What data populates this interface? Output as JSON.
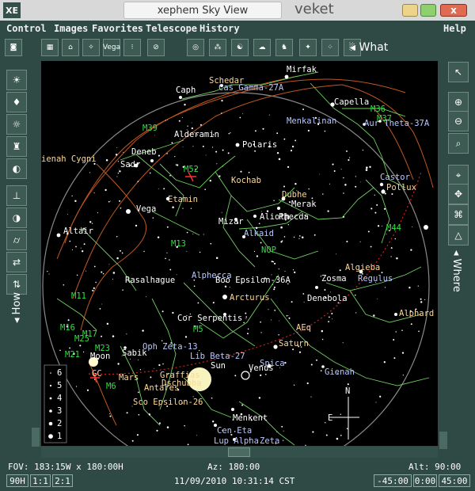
{
  "window": {
    "badge": "XE",
    "title": "xephem Sky View",
    "host": "veket",
    "close_label": "x"
  },
  "menu": {
    "items": [
      "Control",
      "Images",
      "Favorites",
      "Telescope",
      "History"
    ],
    "help": "Help"
  },
  "toolbar": {
    "what_label": "What",
    "vega_label": "Vega"
  },
  "side": {
    "how_label": "How",
    "where_label": "Where"
  },
  "sky": {
    "stars": [
      {
        "name": "Schedar",
        "class": "cons-l"
      },
      {
        "name": "Mirfak",
        "class": "star-l"
      },
      {
        "name": "Caph",
        "class": "star-l"
      },
      {
        "name": "Cas Gamma-27A",
        "class": "blue-l"
      },
      {
        "name": "Capella",
        "class": "star-l"
      },
      {
        "name": "M36",
        "class": "obj-l"
      },
      {
        "name": "M37",
        "class": "obj-l"
      },
      {
        "name": "Menkalinan",
        "class": "blue-l"
      },
      {
        "name": "Aur Theta-37A",
        "class": "blue-l"
      },
      {
        "name": "M39",
        "class": "obj-l"
      },
      {
        "name": "Alderamin",
        "class": "star-l"
      },
      {
        "name": "Polaris",
        "class": "star-l"
      },
      {
        "name": "ienah Cygni",
        "class": "cons-l"
      },
      {
        "name": "Deneb",
        "class": "star-l"
      },
      {
        "name": "Sadr",
        "class": "star-l"
      },
      {
        "name": "M52",
        "class": "obj-l"
      },
      {
        "name": "Kochab",
        "class": "cons-l"
      },
      {
        "name": "Castor",
        "class": "blue-l"
      },
      {
        "name": "Pollux",
        "class": "cons-l"
      },
      {
        "name": "Etamin",
        "class": "cons-l"
      },
      {
        "name": "Dubhe",
        "class": "cons-l"
      },
      {
        "name": "Merak",
        "class": "star-l"
      },
      {
        "name": "Vega",
        "class": "star-l"
      },
      {
        "name": "Mizar",
        "class": "star-l"
      },
      {
        "name": "Alioth",
        "class": "star-l"
      },
      {
        "name": "Phecda",
        "class": "star-l"
      },
      {
        "name": "Alkaid",
        "class": "blue-l"
      },
      {
        "name": "Altair",
        "class": "star-l"
      },
      {
        "name": "M44",
        "class": "obj-l"
      },
      {
        "name": "M13",
        "class": "obj-l"
      },
      {
        "name": "NOP",
        "class": "obj-l"
      },
      {
        "name": "Algieba",
        "class": "cons-l"
      },
      {
        "name": "Rasalhague",
        "class": "star-l"
      },
      {
        "name": "Alphecca",
        "class": "blue-l"
      },
      {
        "name": "Boo Epsilon-36A",
        "class": "star-l"
      },
      {
        "name": "Zosma",
        "class": "star-l"
      },
      {
        "name": "Regulus",
        "class": "blue-l"
      },
      {
        "name": "M11",
        "class": "obj-l"
      },
      {
        "name": "Arcturus",
        "class": "cons-l"
      },
      {
        "name": "Denebola",
        "class": "star-l"
      },
      {
        "name": "Cor Serpentis",
        "class": "star-l"
      },
      {
        "name": "M5",
        "class": "obj-l"
      },
      {
        "name": "Alphard",
        "class": "cons-l"
      },
      {
        "name": "M16",
        "class": "obj-l"
      },
      {
        "name": "M17",
        "class": "obj-l"
      },
      {
        "name": "M25",
        "class": "obj-l"
      },
      {
        "name": "AEq",
        "class": "pl-l"
      },
      {
        "name": "M23",
        "class": "obj-l"
      },
      {
        "name": "Oph Zeta-13",
        "class": "blue-l"
      },
      {
        "name": "Saturn",
        "class": "cons-l"
      },
      {
        "name": "Sabik",
        "class": "star-l"
      },
      {
        "name": "M21",
        "class": "obj-l"
      },
      {
        "name": "Moon",
        "class": "star-l"
      },
      {
        "name": "Lib Beta-27",
        "class": "blue-l"
      },
      {
        "name": "Gienah",
        "class": "blue-l"
      },
      {
        "name": "Spica",
        "class": "blue-l"
      },
      {
        "name": "GC",
        "class": "pl-l"
      },
      {
        "name": "Sun",
        "class": "star-l"
      },
      {
        "name": "Venus",
        "class": "star-l"
      },
      {
        "name": "Mars",
        "class": "cons-l"
      },
      {
        "name": "Graffias",
        "class": "cons-l"
      },
      {
        "name": "Dschubba",
        "class": "cons-l"
      },
      {
        "name": "M6",
        "class": "obj-l"
      },
      {
        "name": "Antares",
        "class": "cons-l"
      },
      {
        "name": "Sco Epsilon-26",
        "class": "cons-l"
      },
      {
        "name": "Menkent",
        "class": "star-l"
      },
      {
        "name": "Cen Eta",
        "class": "blue-l"
      },
      {
        "name": "Lup Alpha",
        "class": "blue-l"
      },
      {
        "name": "Zeta",
        "class": "blue-l"
      }
    ],
    "compass": {
      "n": "N",
      "e": "E"
    },
    "magnitudes": [
      "6",
      "5",
      "4",
      "3",
      "2",
      "1"
    ]
  },
  "status": {
    "fov": "FOV: 183:15W x 180:00H",
    "az": "Az: 180:00",
    "alt": "Alt: 90:00",
    "datetime": "11/09/2010 10:31:14 CST",
    "left_buttons": [
      "90H",
      "1:1",
      "2:1"
    ],
    "right_buttons": [
      "-45:00",
      "0:00",
      "45:00"
    ]
  }
}
